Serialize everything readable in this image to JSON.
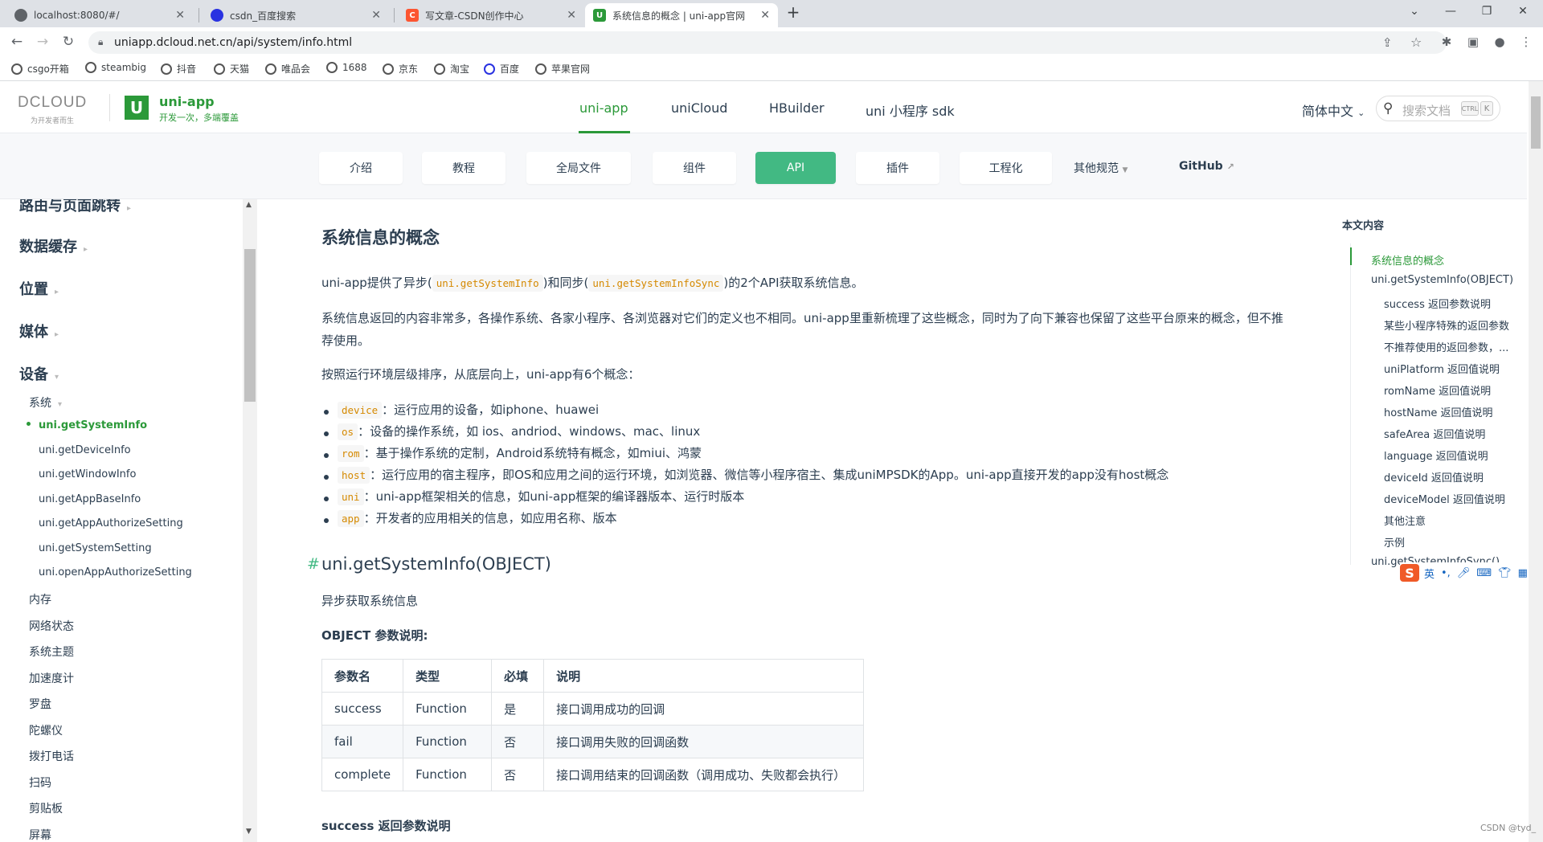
{
  "browser": {
    "tabs": [
      {
        "title": "localhost:8080/#/",
        "favicon_color": "#5f6368"
      },
      {
        "title": "csdn_百度搜索",
        "favicon_color": "#2932e1"
      },
      {
        "title": "写文章-CSDN创作中心",
        "favicon_color": "#fc5531"
      },
      {
        "title": "系统信息的概念 | uni-app官网",
        "favicon_color": "#2b9939"
      }
    ],
    "url": "uniapp.dcloud.net.cn/api/system/info.html",
    "bookmarks": [
      "csgo开箱",
      "steambig",
      "抖音",
      "天猫",
      "唯品会",
      "1688",
      "京东",
      "淘宝",
      "百度",
      "苹果官网"
    ]
  },
  "header": {
    "dcloud_logo": "DCLOUD",
    "dcloud_slogan": "为开发者而生",
    "brand_name": "uni-app",
    "brand_slogan": "开发一次，多端覆盖",
    "nav": [
      "uni-app",
      "uniCloud",
      "HBuilder",
      "uni 小程序 sdk"
    ],
    "lang": "简体中文",
    "search_placeholder": "搜索文档",
    "kbd_ctrl": "CTRL",
    "kbd_k": "K"
  },
  "subnav": {
    "buttons": [
      "介绍",
      "教程",
      "全局文件",
      "组件",
      "API",
      "插件",
      "工程化"
    ],
    "other": "其他规范",
    "github": "GitHub"
  },
  "sidebar": {
    "top_partial": "路由与页面跳转",
    "sections": [
      "数据缓存",
      "位置",
      "媒体",
      "设备"
    ],
    "group": "系统",
    "items": [
      "uni.getSystemInfo",
      "uni.getDeviceInfo",
      "uni.getWindowInfo",
      "uni.getAppBaseInfo",
      "uni.getAppAuthorizeSetting",
      "uni.getSystemSetting",
      "uni.openAppAuthorizeSetting"
    ],
    "more": [
      "内存",
      "网络状态",
      "系统主题",
      "加速度计",
      "罗盘",
      "陀螺仪",
      "拨打电话",
      "扫码",
      "剪贴板",
      "屏幕"
    ]
  },
  "content": {
    "title": "系统信息的概念",
    "p1_pre": "uni-app提供了异步(",
    "p1_code1": "uni.getSystemInfo",
    "p1_mid": ")和同步(",
    "p1_code2": "uni.getSystemInfoSync",
    "p1_post": ")的2个API获取系统信息。",
    "p2": "系统信息返回的内容非常多，各操作系统、各家小程序、各浏览器对它们的定义也不相同。uni-app里重新梳理了这些概念，同时为了向下兼容也保留了这些平台原来的概念，但不推荐使用。",
    "p3": "按照运行环境层级排序，从底层向上，uni-app有6个概念：",
    "concepts": [
      {
        "code": "device",
        "text": "：运行应用的设备，如iphone、huawei"
      },
      {
        "code": "os",
        "text": "：设备的操作系统，如 ios、andriod、windows、mac、linux"
      },
      {
        "code": "rom",
        "text": "：基于操作系统的定制，Android系统特有概念，如miui、鸿蒙"
      },
      {
        "code": "host",
        "text": "：运行应用的宿主程序，即OS和应用之间的运行环境，如浏览器、微信等小程序宿主、集成uniMPSDK的App。uni-app直接开发的app没有host概念"
      },
      {
        "code": "uni",
        "text": "：uni-app框架相关的信息，如uni-app框架的编译器版本、运行时版本"
      },
      {
        "code": "app",
        "text": "：开发者的应用相关的信息，如应用名称、版本"
      }
    ],
    "h2": "uni.getSystemInfo(OBJECT)",
    "hash": "#",
    "desc": "异步获取系统信息",
    "obj_title": "OBJECT 参数说明:",
    "table": {
      "headers": [
        "参数名",
        "类型",
        "必填",
        "说明"
      ],
      "rows": [
        [
          "success",
          "Function",
          "是",
          "接口调用成功的回调"
        ],
        [
          "fail",
          "Function",
          "否",
          "接口调用失败的回调函数"
        ],
        [
          "complete",
          "Function",
          "否",
          "接口调用结束的回调函数（调用成功、失败都会执行）"
        ]
      ]
    },
    "next_title": "success 返回参数说明"
  },
  "toc": {
    "title": "本文内容",
    "items": [
      {
        "label": "系统信息的概念",
        "level": 1,
        "active": true
      },
      {
        "label": "uni.getSystemInfo(OBJECT)",
        "level": 1
      },
      {
        "label": "success 返回参数说明",
        "level": 2
      },
      {
        "label": "某些小程序特殊的返回参数",
        "level": 2
      },
      {
        "label": "不推荐使用的返回参数，...",
        "level": 2
      },
      {
        "label": "uniPlatform 返回值说明",
        "level": 2
      },
      {
        "label": "romName 返回值说明",
        "level": 2
      },
      {
        "label": "hostName 返回值说明",
        "level": 2
      },
      {
        "label": "safeArea 返回值说明",
        "level": 2
      },
      {
        "label": "language 返回值说明",
        "level": 2
      },
      {
        "label": "deviceId 返回值说明",
        "level": 2
      },
      {
        "label": "deviceModel 返回值说明",
        "level": 2
      },
      {
        "label": "其他注意",
        "level": 2
      },
      {
        "label": "示例",
        "level": 2
      },
      {
        "label": "uni.getSystemInfoSync()",
        "level": 1
      }
    ]
  },
  "ime": {
    "logo": "S",
    "mode": "英"
  },
  "watermark": "CSDN @tyd_",
  "colors": {
    "brand": "#2b9939",
    "accent": "#42b983",
    "code": "#d58900"
  }
}
